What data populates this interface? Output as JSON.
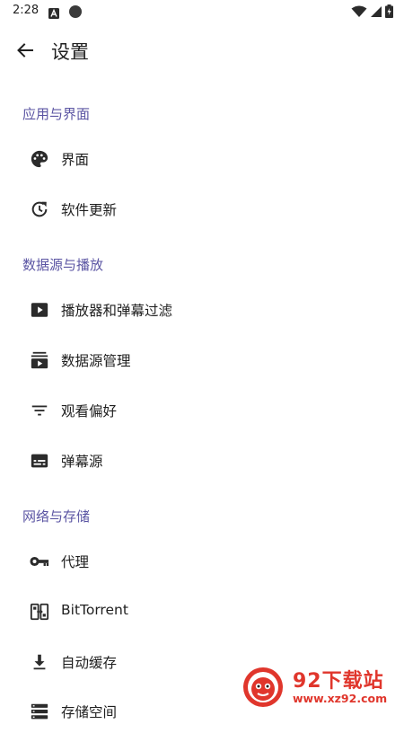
{
  "status_bar": {
    "time": "2:28",
    "icons_left": [
      "a-badge-icon",
      "circle-dot-icon"
    ],
    "icons_right": [
      "wifi-icon",
      "cellular-signal-icon",
      "battery-icon"
    ]
  },
  "app_bar": {
    "back_icon": "arrow-back-icon",
    "title": "设置"
  },
  "sections": [
    {
      "header": "应用与界面",
      "items": [
        {
          "icon": "palette-icon",
          "label": "界面"
        },
        {
          "icon": "update-icon",
          "label": "软件更新"
        }
      ]
    },
    {
      "header": "数据源与播放",
      "items": [
        {
          "icon": "play-box-icon",
          "label": "播放器和弹幕过滤"
        },
        {
          "icon": "subscriptions-icon",
          "label": "数据源管理"
        },
        {
          "icon": "filter-list-icon",
          "label": "观看偏好"
        },
        {
          "icon": "subtitles-icon",
          "label": "弹幕源"
        }
      ]
    },
    {
      "header": "网络与存储",
      "items": [
        {
          "icon": "key-icon",
          "label": "代理"
        },
        {
          "icon": "bittorrent-icon",
          "label": "BitTorrent"
        },
        {
          "icon": "download-icon",
          "label": "自动缓存"
        },
        {
          "icon": "storage-icon",
          "label": "存储空间"
        }
      ]
    }
  ],
  "watermark": {
    "title": "92下载站",
    "url": "www.xz92.com"
  },
  "colors": {
    "section_header": "#5b55a3",
    "text": "#1f1f1f",
    "icon": "#2b2b2b",
    "watermark": "#e0362c"
  }
}
